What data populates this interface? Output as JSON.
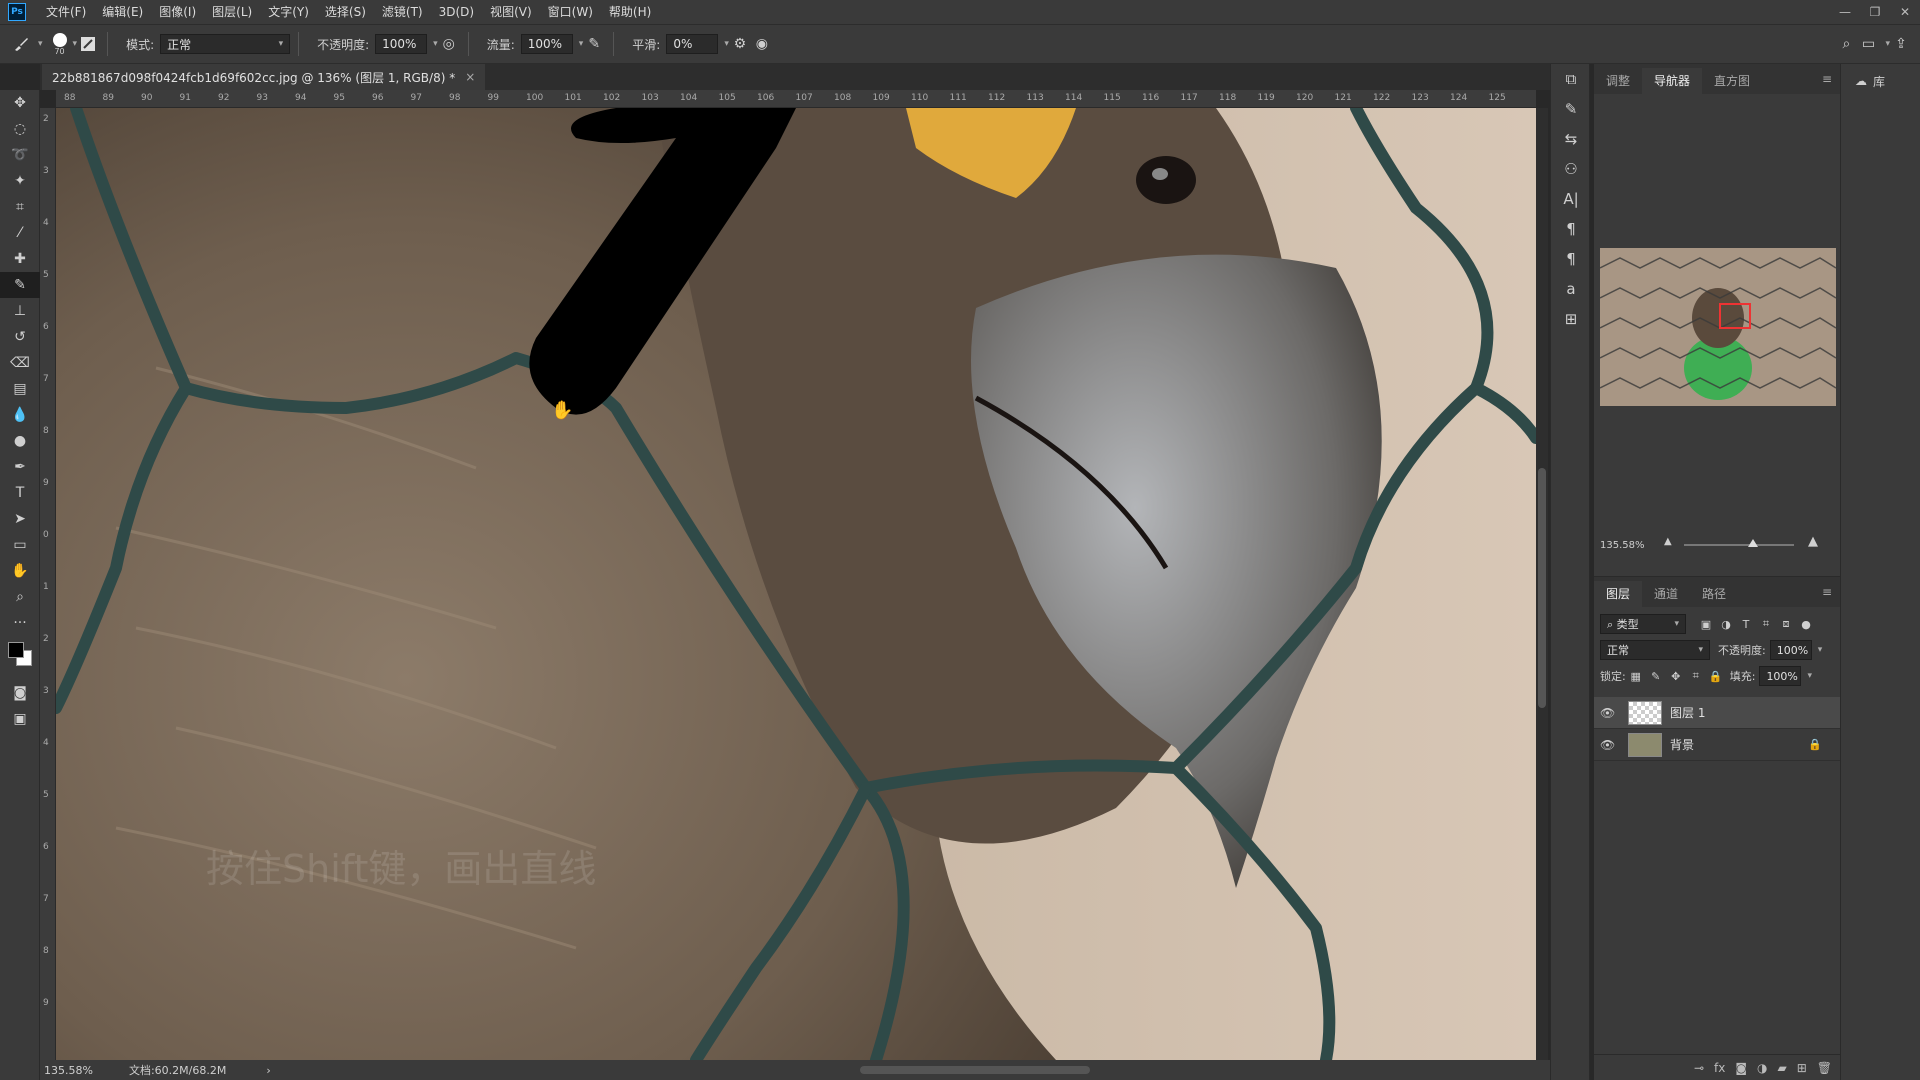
{
  "app": {
    "logo": "Ps"
  },
  "menu": [
    "文件(F)",
    "编辑(E)",
    "图像(I)",
    "图层(L)",
    "文字(Y)",
    "选择(S)",
    "滤镜(T)",
    "3D(D)",
    "视图(V)",
    "窗口(W)",
    "帮助(H)"
  ],
  "window_controls": {
    "minimize": "—",
    "restore": "❐",
    "close": "✕"
  },
  "options": {
    "brush_size": "70",
    "mode_label": "模式:",
    "mode_value": "正常",
    "opacity_label": "不透明度:",
    "opacity_value": "100%",
    "flow_label": "流量:",
    "flow_value": "100%",
    "smooth_label": "平滑:",
    "smooth_value": "0%"
  },
  "document": {
    "tab_title": "22b881867d098f0424fcb1d69f602cc.jpg @ 136% (图层 1, RGB/8) *",
    "close": "×"
  },
  "ruler": {
    "top_ticks": [
      "88",
      "89",
      "90",
      "91",
      "92",
      "93",
      "94",
      "95",
      "96",
      "97",
      "98",
      "99",
      "100",
      "101",
      "102",
      "103",
      "104",
      "105",
      "106",
      "107",
      "108",
      "109",
      "110",
      "111",
      "112",
      "113",
      "114",
      "115",
      "116",
      "117",
      "118",
      "119",
      "120",
      "121",
      "122",
      "123",
      "124",
      "125"
    ],
    "left_ticks": [
      "2",
      "3",
      "4",
      "5",
      "6",
      "7",
      "8",
      "9",
      "0",
      "1",
      "2",
      "3",
      "4",
      "5",
      "6",
      "7",
      "8",
      "9"
    ]
  },
  "status": {
    "zoom": "135.58%",
    "doc_size": "文档:60.2M/68.2M",
    "arrow": "›"
  },
  "watermark": "按住Shift键，画出直线",
  "panels": {
    "top_tabs": [
      "调整",
      "导航器",
      "直方图"
    ],
    "active_top_tab": "导航器",
    "nav_zoom": "135.58%",
    "layers_tabs": [
      "图层",
      "通道",
      "路径"
    ],
    "filter_label": "类型",
    "blend_mode": "正常",
    "opacity_label": "不透明度:",
    "opacity_value": "100%",
    "lock_label": "锁定:",
    "fill_label": "填充:",
    "fill_value": "100%",
    "layers": [
      {
        "name": "图层 1",
        "selected": true
      },
      {
        "name": "背景",
        "selected": false,
        "locked": true
      }
    ]
  },
  "dock": {
    "libraries_label": "库"
  },
  "colors": {
    "accent": "#31a8ff",
    "panel_bg": "#3a3a3a",
    "canvas_bird": "#7a6a5a",
    "wire": "#2f4a48",
    "brush_stroke": "#000000"
  }
}
